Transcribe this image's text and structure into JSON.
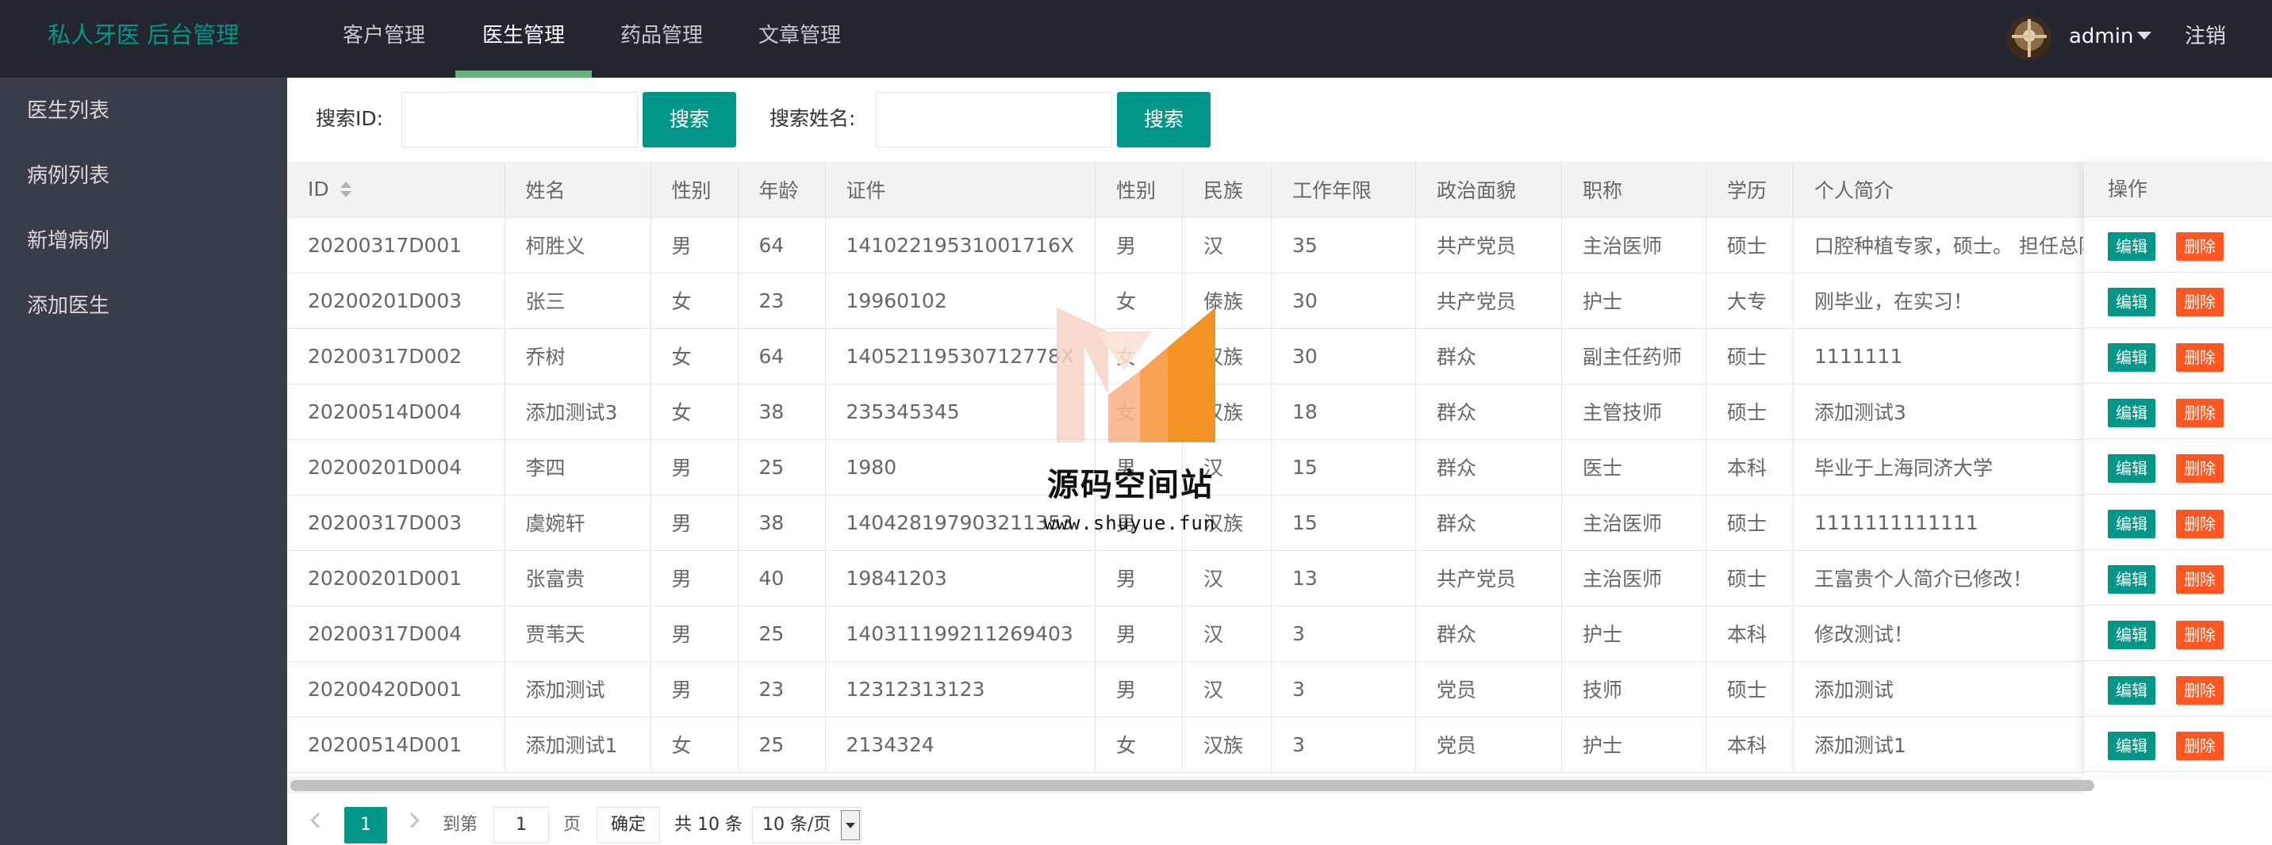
{
  "app": {
    "title": "私人牙医 后台管理"
  },
  "nav": {
    "items": [
      {
        "label": "客户管理"
      },
      {
        "label": "医生管理"
      },
      {
        "label": "药品管理"
      },
      {
        "label": "文章管理"
      }
    ],
    "active": "医生管理"
  },
  "user": {
    "name": "admin",
    "logout": "注销"
  },
  "sidebar": {
    "items": [
      {
        "label": "医生列表"
      },
      {
        "label": "病例列表"
      },
      {
        "label": "新增病例"
      },
      {
        "label": "添加医生"
      }
    ]
  },
  "search": {
    "id_label": "搜索ID:",
    "id_value": "",
    "name_label": "搜索姓名:",
    "name_value": "",
    "button_label": "搜索"
  },
  "table": {
    "columns": [
      "ID",
      "姓名",
      "性别",
      "年龄",
      "证件",
      "性别",
      "民族",
      "工作年限",
      "政治面貌",
      "职称",
      "学历",
      "个人简介"
    ],
    "ops_header": "操作",
    "edit_label": "编辑",
    "delete_label": "删除",
    "rows": [
      [
        "20200317D001",
        "柯胜义",
        "男",
        "64",
        "14102219531001716X",
        "男",
        "汉",
        "35",
        "共产党员",
        "主治医师",
        "硕士",
        "口腔种植专家，硕士。 担任总防"
      ],
      [
        "20200201D003",
        "张三",
        "女",
        "23",
        "19960102",
        "女",
        "傣族",
        "30",
        "共产党员",
        "护士",
        "大专",
        "刚毕业，在实习！"
      ],
      [
        "20200317D002",
        "乔树",
        "女",
        "64",
        "14052119530712778X",
        "女",
        "汉族",
        "30",
        "群众",
        "副主任药师",
        "硕士",
        "1111111"
      ],
      [
        "20200514D004",
        "添加测试3",
        "女",
        "38",
        "235345345",
        "女",
        "汉族",
        "18",
        "群众",
        "主管技师",
        "硕士",
        "添加测试3"
      ],
      [
        "20200201D004",
        "李四",
        "男",
        "25",
        "1980",
        "男",
        "汉",
        "15",
        "群众",
        "医士",
        "本科",
        "毕业于上海同济大学"
      ],
      [
        "20200317D003",
        "虞婉轩",
        "男",
        "38",
        "140428197903211353",
        "男",
        "汉族",
        "15",
        "群众",
        "主治医师",
        "硕士",
        "1111111111111"
      ],
      [
        "20200201D001",
        "张富贵",
        "男",
        "40",
        "19841203",
        "男",
        "汉",
        "13",
        "共产党员",
        "主治医师",
        "硕士",
        "王富贵个人简介已修改！"
      ],
      [
        "20200317D004",
        "贾苇天",
        "男",
        "25",
        "140311199211269403",
        "男",
        "汉",
        "3",
        "群众",
        "护士",
        "本科",
        "修改测试！"
      ],
      [
        "20200420D001",
        "添加测试",
        "男",
        "23",
        "12312313123",
        "男",
        "汉",
        "3",
        "党员",
        "技师",
        "硕士",
        "添加测试"
      ],
      [
        "20200514D001",
        "添加测试1",
        "女",
        "25",
        "2134324",
        "女",
        "汉族",
        "3",
        "党员",
        "护士",
        "本科",
        "添加测试1"
      ]
    ]
  },
  "pager": {
    "current": "1",
    "goto_label": "到第",
    "goto_value": "1",
    "page_unit": "页",
    "confirm": "确定",
    "total": "共 10 条",
    "page_size": "10 条/页"
  },
  "watermark": {
    "text": "源码空间站",
    "url": "www.shuyue.fun"
  },
  "colors": {
    "header": "#23262e",
    "sidebar": "#393d49",
    "accent": "#009688",
    "danger": "#ff5722",
    "active_bar": "#5fb878"
  }
}
